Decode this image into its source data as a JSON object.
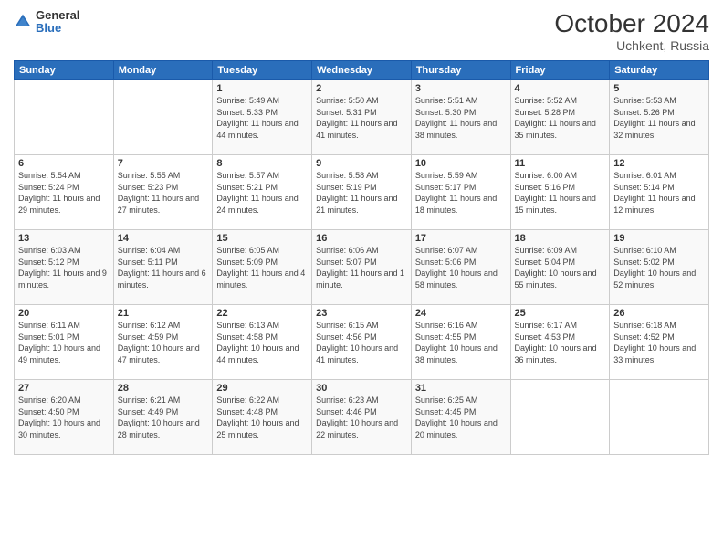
{
  "header": {
    "logo_general": "General",
    "logo_blue": "Blue",
    "month": "October 2024",
    "location": "Uchkent, Russia"
  },
  "weekdays": [
    "Sunday",
    "Monday",
    "Tuesday",
    "Wednesday",
    "Thursday",
    "Friday",
    "Saturday"
  ],
  "weeks": [
    [
      {
        "day": "",
        "info": ""
      },
      {
        "day": "",
        "info": ""
      },
      {
        "day": "1",
        "info": "Sunrise: 5:49 AM\nSunset: 5:33 PM\nDaylight: 11 hours and 44 minutes."
      },
      {
        "day": "2",
        "info": "Sunrise: 5:50 AM\nSunset: 5:31 PM\nDaylight: 11 hours and 41 minutes."
      },
      {
        "day": "3",
        "info": "Sunrise: 5:51 AM\nSunset: 5:30 PM\nDaylight: 11 hours and 38 minutes."
      },
      {
        "day": "4",
        "info": "Sunrise: 5:52 AM\nSunset: 5:28 PM\nDaylight: 11 hours and 35 minutes."
      },
      {
        "day": "5",
        "info": "Sunrise: 5:53 AM\nSunset: 5:26 PM\nDaylight: 11 hours and 32 minutes."
      }
    ],
    [
      {
        "day": "6",
        "info": "Sunrise: 5:54 AM\nSunset: 5:24 PM\nDaylight: 11 hours and 29 minutes."
      },
      {
        "day": "7",
        "info": "Sunrise: 5:55 AM\nSunset: 5:23 PM\nDaylight: 11 hours and 27 minutes."
      },
      {
        "day": "8",
        "info": "Sunrise: 5:57 AM\nSunset: 5:21 PM\nDaylight: 11 hours and 24 minutes."
      },
      {
        "day": "9",
        "info": "Sunrise: 5:58 AM\nSunset: 5:19 PM\nDaylight: 11 hours and 21 minutes."
      },
      {
        "day": "10",
        "info": "Sunrise: 5:59 AM\nSunset: 5:17 PM\nDaylight: 11 hours and 18 minutes."
      },
      {
        "day": "11",
        "info": "Sunrise: 6:00 AM\nSunset: 5:16 PM\nDaylight: 11 hours and 15 minutes."
      },
      {
        "day": "12",
        "info": "Sunrise: 6:01 AM\nSunset: 5:14 PM\nDaylight: 11 hours and 12 minutes."
      }
    ],
    [
      {
        "day": "13",
        "info": "Sunrise: 6:03 AM\nSunset: 5:12 PM\nDaylight: 11 hours and 9 minutes."
      },
      {
        "day": "14",
        "info": "Sunrise: 6:04 AM\nSunset: 5:11 PM\nDaylight: 11 hours and 6 minutes."
      },
      {
        "day": "15",
        "info": "Sunrise: 6:05 AM\nSunset: 5:09 PM\nDaylight: 11 hours and 4 minutes."
      },
      {
        "day": "16",
        "info": "Sunrise: 6:06 AM\nSunset: 5:07 PM\nDaylight: 11 hours and 1 minute."
      },
      {
        "day": "17",
        "info": "Sunrise: 6:07 AM\nSunset: 5:06 PM\nDaylight: 10 hours and 58 minutes."
      },
      {
        "day": "18",
        "info": "Sunrise: 6:09 AM\nSunset: 5:04 PM\nDaylight: 10 hours and 55 minutes."
      },
      {
        "day": "19",
        "info": "Sunrise: 6:10 AM\nSunset: 5:02 PM\nDaylight: 10 hours and 52 minutes."
      }
    ],
    [
      {
        "day": "20",
        "info": "Sunrise: 6:11 AM\nSunset: 5:01 PM\nDaylight: 10 hours and 49 minutes."
      },
      {
        "day": "21",
        "info": "Sunrise: 6:12 AM\nSunset: 4:59 PM\nDaylight: 10 hours and 47 minutes."
      },
      {
        "day": "22",
        "info": "Sunrise: 6:13 AM\nSunset: 4:58 PM\nDaylight: 10 hours and 44 minutes."
      },
      {
        "day": "23",
        "info": "Sunrise: 6:15 AM\nSunset: 4:56 PM\nDaylight: 10 hours and 41 minutes."
      },
      {
        "day": "24",
        "info": "Sunrise: 6:16 AM\nSunset: 4:55 PM\nDaylight: 10 hours and 38 minutes."
      },
      {
        "day": "25",
        "info": "Sunrise: 6:17 AM\nSunset: 4:53 PM\nDaylight: 10 hours and 36 minutes."
      },
      {
        "day": "26",
        "info": "Sunrise: 6:18 AM\nSunset: 4:52 PM\nDaylight: 10 hours and 33 minutes."
      }
    ],
    [
      {
        "day": "27",
        "info": "Sunrise: 6:20 AM\nSunset: 4:50 PM\nDaylight: 10 hours and 30 minutes."
      },
      {
        "day": "28",
        "info": "Sunrise: 6:21 AM\nSunset: 4:49 PM\nDaylight: 10 hours and 28 minutes."
      },
      {
        "day": "29",
        "info": "Sunrise: 6:22 AM\nSunset: 4:48 PM\nDaylight: 10 hours and 25 minutes."
      },
      {
        "day": "30",
        "info": "Sunrise: 6:23 AM\nSunset: 4:46 PM\nDaylight: 10 hours and 22 minutes."
      },
      {
        "day": "31",
        "info": "Sunrise: 6:25 AM\nSunset: 4:45 PM\nDaylight: 10 hours and 20 minutes."
      },
      {
        "day": "",
        "info": ""
      },
      {
        "day": "",
        "info": ""
      }
    ]
  ]
}
